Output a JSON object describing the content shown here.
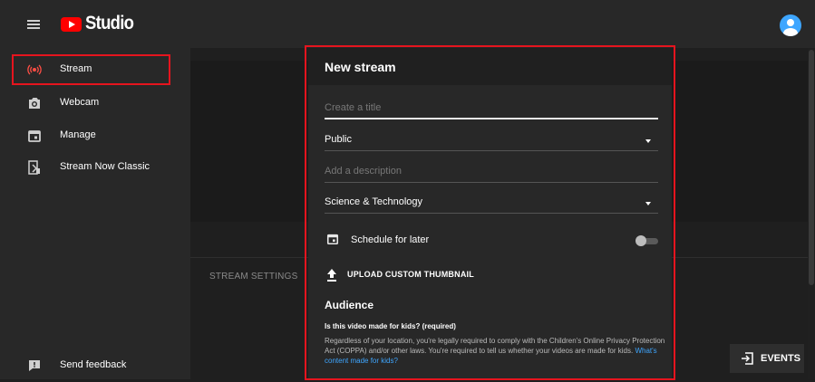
{
  "app": {
    "logo_text": "Studio",
    "brand_color": "#ff0000",
    "highlight_color": "#e6141e"
  },
  "header": {
    "menu_icon": "hamburger-icon",
    "avatar_icon": "account-avatar-icon"
  },
  "sidebar": {
    "items": [
      {
        "label": "Stream",
        "icon": "live-broadcast-icon",
        "active": true
      },
      {
        "label": "Webcam",
        "icon": "camera-icon"
      },
      {
        "label": "Manage",
        "icon": "calendar-icon"
      },
      {
        "label": "Stream Now Classic",
        "icon": "stream-now-classic-icon"
      }
    ],
    "feedback": {
      "label": "Send feedback",
      "icon": "feedback-icon"
    }
  },
  "background": {
    "stream_settings_label": "STREAM SETTINGS"
  },
  "dialog": {
    "title": "New stream",
    "title_placeholder": "Create a title",
    "visibility": "Public",
    "description_placeholder": "Add a description",
    "category": "Science & Technology",
    "schedule_label": "Schedule for later",
    "schedule_enabled": false,
    "upload_label": "UPLOAD CUSTOM THUMBNAIL",
    "audience_heading": "Audience",
    "kids_question": "Is this video made for kids? (required)",
    "kids_text": "Regardless of your location, you're legally required to comply with the Children's Online Privacy Protection Act (COPPA) and/or other laws. You're required to tell us whether your videos are made for kids. ",
    "kids_link": "What's content made for kids?"
  },
  "events_button": {
    "label": "EVENTS",
    "icon": "events-enter-icon"
  }
}
